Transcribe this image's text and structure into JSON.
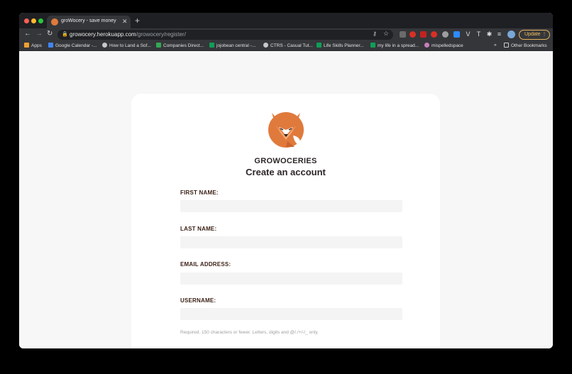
{
  "browser": {
    "tab_title": "groWocery - save money and ti",
    "tab_close": "✕",
    "new_tab": "+",
    "url_host": "growocery.herokuapp.com",
    "url_path": "/growocery/register/",
    "update_label": "Update",
    "update_menu": "⋮"
  },
  "bookmarks": {
    "items": [
      {
        "label": "Apps",
        "color": "#f0a030"
      },
      {
        "label": "Google Calendar -...",
        "color": "#4285f4"
      },
      {
        "label": "How to Land a Sof...",
        "color": "#c8c8c8"
      },
      {
        "label": "Companies Direct...",
        "color": "#34a853"
      },
      {
        "label": "jojobean central -...",
        "color": "#0f9d58"
      },
      {
        "label": "CTRS - Casual Tut...",
        "color": "#c8c8c8"
      },
      {
        "label": "Life Skills Planner...",
        "color": "#0f9d58"
      },
      {
        "label": "my life in a spread...",
        "color": "#0f9d58"
      },
      {
        "label": "mispelledspace",
        "color": "#c77dba"
      }
    ],
    "more": "»",
    "other": "Other Bookmarks"
  },
  "form": {
    "brand": "GROWOCERIES",
    "title": "Create an account",
    "first_name_label": "FIRST NAME:",
    "first_name_value": "",
    "last_name_label": "LAST NAME:",
    "last_name_value": "",
    "email_label": "EMAIL ADDRESS:",
    "email_value": "",
    "username_label": "USERNAME:",
    "username_value": "",
    "username_help": "Required. 150 characters or fewer. Letters, digits and @/./+/-/_ only."
  },
  "colors": {
    "brand_orange": "#e07a3c",
    "label_brown": "#3a1f14"
  }
}
